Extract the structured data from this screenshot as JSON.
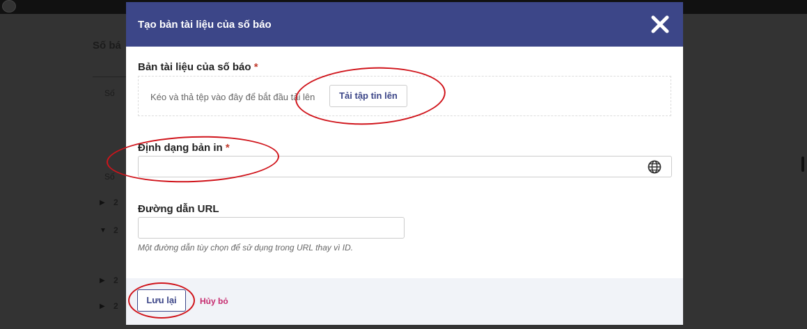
{
  "modal": {
    "title": "Tạo bản tài liệu của số báo",
    "close_icon": "close-icon"
  },
  "document_field": {
    "label": "Bản tài liệu của số báo",
    "required_mark": "*",
    "drop_text": "Kéo và thả tệp vào đây để bắt đầu tải lên",
    "upload_label": "Tải tập tin lên"
  },
  "print_format_field": {
    "label": "Định dạng bản in",
    "required_mark": "*",
    "value": "",
    "icon": "globe-icon"
  },
  "url_field": {
    "label": "Đường dẫn URL",
    "value": "",
    "help": "Một đường dẫn tùy chọn để sử dụng trong URL thay vì ID."
  },
  "footer": {
    "save_label": "Lưu lại",
    "cancel_label": "Hủy bỏ"
  },
  "background": {
    "heading_fragment": "Số bá",
    "row_fragments": [
      "Số",
      "Số",
      "2",
      "2",
      "2",
      "2"
    ]
  },
  "colors": {
    "header_bg": "#3c4688",
    "accent": "#3c4688",
    "cancel": "#c62a6e",
    "required": "#c0392b",
    "annotation": "#d0141b"
  }
}
